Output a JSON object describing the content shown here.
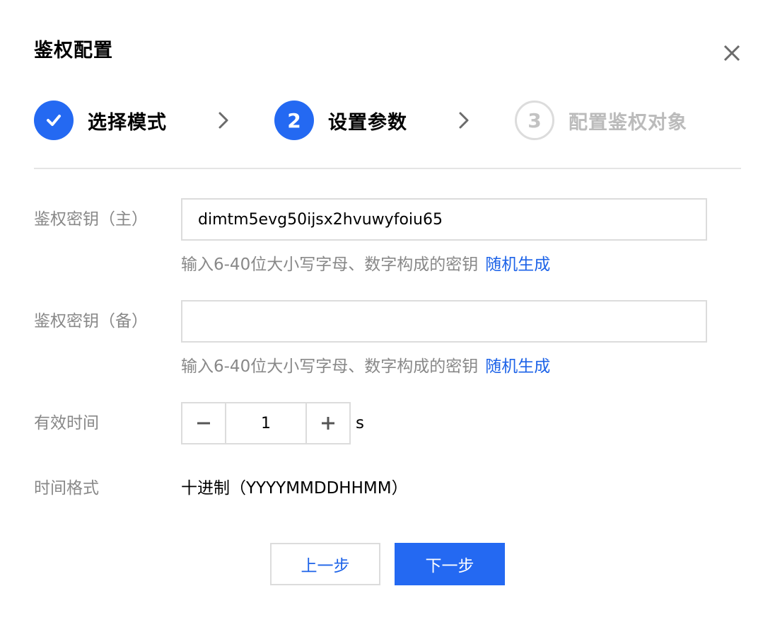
{
  "dialog": {
    "title": "鉴权配置",
    "close_icon": "close-icon"
  },
  "steps": [
    {
      "number": "",
      "label": "选择模式",
      "state": "done",
      "icon": "check-icon"
    },
    {
      "number": "2",
      "label": "设置参数",
      "state": "active"
    },
    {
      "number": "3",
      "label": "配置鉴权对象",
      "state": "pending"
    }
  ],
  "form": {
    "primary_key": {
      "label": "鉴权密钥（主）",
      "value": "dimtm5evg50ijsx2hvuwyfoiu65",
      "hint": "输入6-40位大小写字母、数字构成的密钥",
      "link": "随机生成"
    },
    "backup_key": {
      "label": "鉴权密钥（备）",
      "value": "",
      "hint": "输入6-40位大小写字母、数字构成的密钥",
      "link": "随机生成"
    },
    "validity": {
      "label": "有效时间",
      "value": "1",
      "unit": "s"
    },
    "time_format": {
      "label": "时间格式",
      "value": "十进制（YYYYMMDDHHMM）"
    }
  },
  "footer": {
    "prev_label": "上一步",
    "next_label": "下一步"
  },
  "colors": {
    "primary": "#2469f2",
    "link": "#1d63e8",
    "muted_text": "#888888",
    "border": "#dcdcdc"
  }
}
